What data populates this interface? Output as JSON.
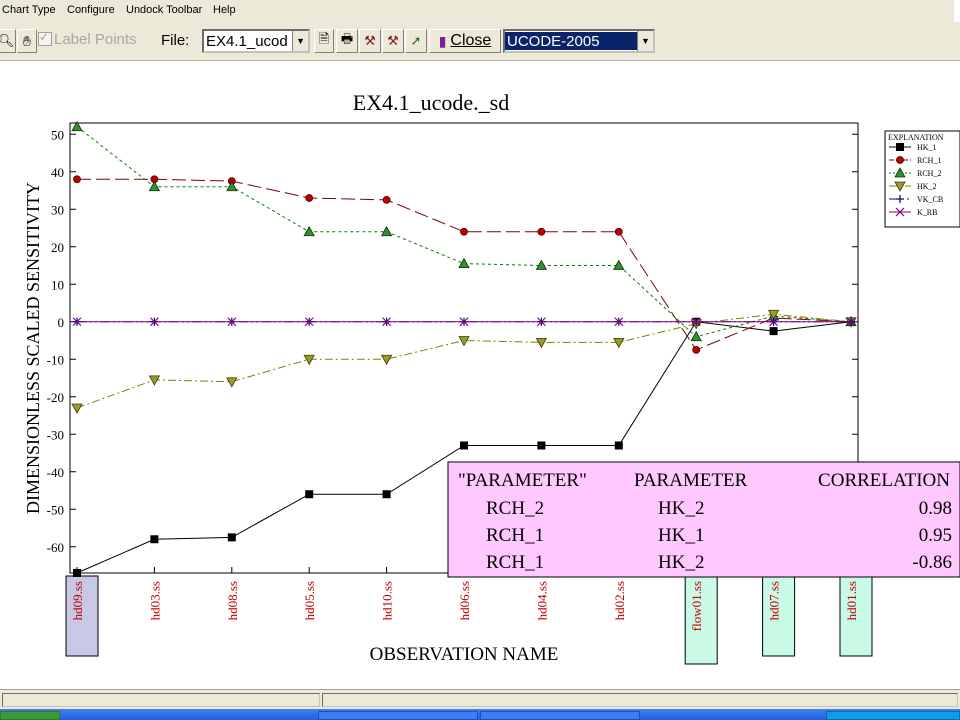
{
  "menu": {
    "items": [
      "Chart Type",
      "Configure",
      "Undock Toolbar",
      "Help"
    ]
  },
  "toolbar": {
    "label_points": "Label Points",
    "file_label": "File:",
    "file_value": "EX4.1_ucod",
    "close_label": "Close",
    "program_value": "UCODE-2005"
  },
  "colors": {
    "accent_selected": "#0a246a",
    "table_bg": "#ffc8ff",
    "obs_box_head": "#c8c8e6",
    "obs_box_flow": "#c8fae6"
  },
  "chart_data": {
    "type": "line",
    "title": "EX4.1_ucode._sd",
    "xlabel": "OBSERVATION NAME",
    "ylabel": "DIMENSIONLESS SCALED SENSITIVITY",
    "ylim": [
      -67,
      53
    ],
    "yticks": [
      50,
      40,
      30,
      20,
      10,
      0,
      -10,
      -20,
      -30,
      -40,
      -50,
      -60
    ],
    "grid": false,
    "legend_position": "right",
    "legend_title": "EXPLANATION",
    "categories": [
      "hd09.ss",
      "hd03.ss",
      "hd08.ss",
      "hd05.ss",
      "hd10.ss",
      "hd06.ss",
      "hd04.ss",
      "hd02.ss",
      "flow01.ss",
      "hd07.ss",
      "hd01.ss"
    ],
    "category_boxes": {
      "hd09.ss": "#c8c8e6",
      "flow01.ss": "#c8fae6",
      "hd07.ss": "#c8fae6",
      "hd01.ss": "#c8fae6"
    },
    "series": [
      {
        "name": "HK_1",
        "color": "#000000",
        "dash": "",
        "marker": "square",
        "values": [
          -67,
          -58,
          -57.5,
          -46,
          -46,
          -33,
          -33,
          -33,
          0,
          -2.5,
          0
        ]
      },
      {
        "name": "RCH_1",
        "color": "#800000",
        "dash": "14,5",
        "marker": "circle",
        "values": [
          38,
          38,
          37.5,
          33,
          32.5,
          24,
          24,
          24,
          -7.5,
          1,
          0
        ]
      },
      {
        "name": "RCH_2",
        "color": "#008000",
        "dash": "3,3",
        "marker": "triangle-up",
        "values": [
          52,
          36,
          36,
          24,
          24,
          15.5,
          15,
          15,
          -4,
          1.5,
          0
        ]
      },
      {
        "name": "HK_2",
        "color": "#808000",
        "dash": "8,3,2,3",
        "marker": "triangle-down",
        "values": [
          -23,
          -15.5,
          -16,
          -10,
          -10,
          -5,
          -5.5,
          -5.5,
          -0.5,
          2,
          0
        ]
      },
      {
        "name": "VK_CB",
        "color": "#000080",
        "dash": "10,3,2,3,2,3",
        "marker": "plus",
        "values": [
          0,
          0,
          0,
          0,
          0,
          0,
          0,
          0,
          0,
          0,
          0
        ]
      },
      {
        "name": "K_RB",
        "color": "#800080",
        "dash": "",
        "marker": "x",
        "values": [
          0,
          0,
          0,
          0,
          0,
          0,
          0,
          0,
          0,
          0,
          0
        ]
      }
    ]
  },
  "correlation_table": {
    "headers": [
      "\"PARAMETER\"",
      "PARAMETER",
      "CORRELATION"
    ],
    "rows": [
      [
        "RCH_2",
        "HK_2",
        "0.98"
      ],
      [
        "RCH_1",
        "HK_1",
        "0.95"
      ],
      [
        "RCH_1",
        "HK_2",
        "-0.86"
      ]
    ]
  }
}
